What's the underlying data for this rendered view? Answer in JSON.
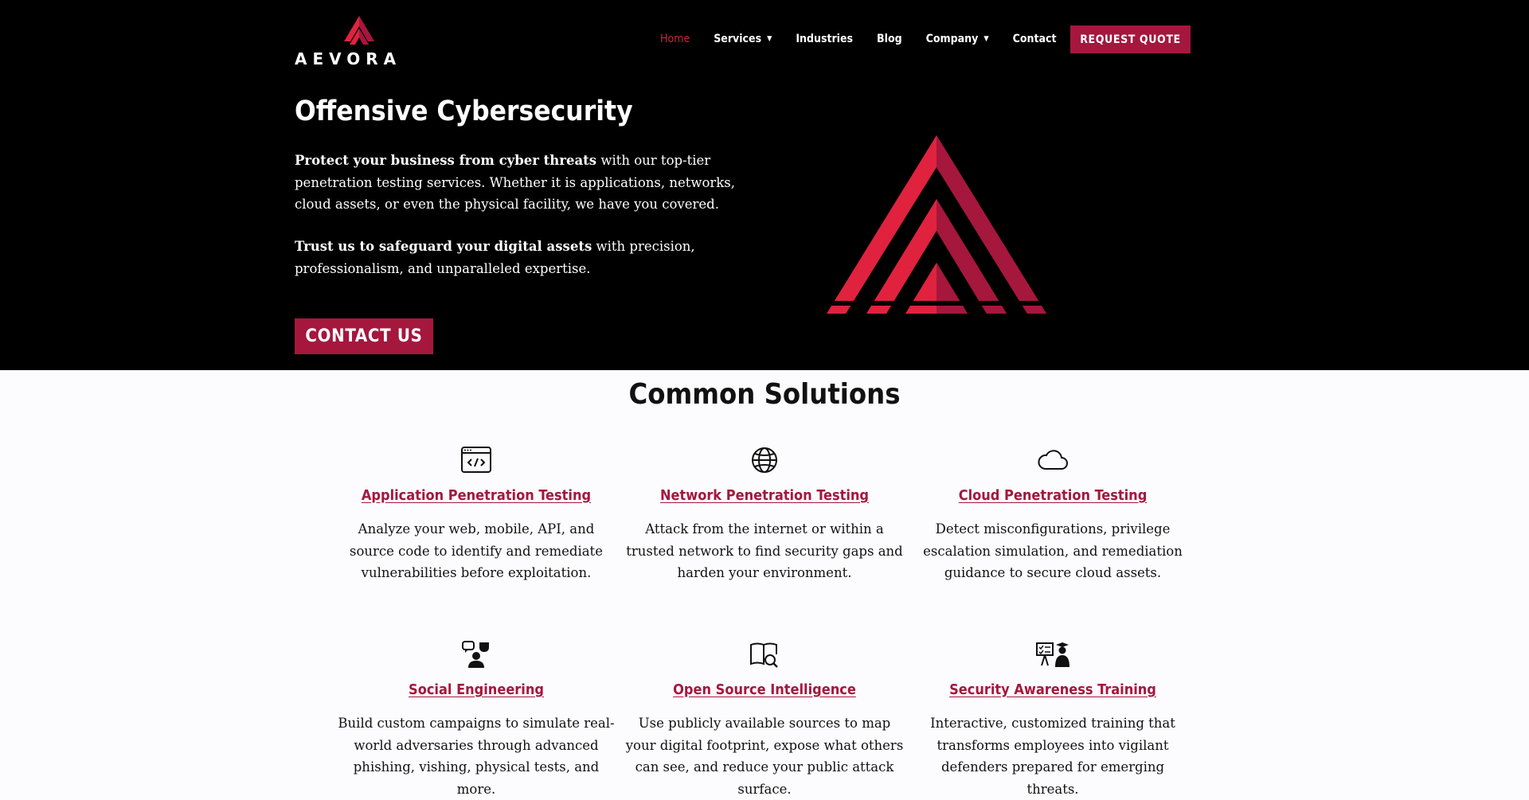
{
  "brand": {
    "name": "AEVORA",
    "accent": "#a5173d",
    "logo_red": "#e0223f"
  },
  "nav": {
    "items": [
      {
        "label": "Home",
        "active": true,
        "dropdown": false
      },
      {
        "label": "Services",
        "active": false,
        "dropdown": true
      },
      {
        "label": "Industries",
        "active": false,
        "dropdown": false
      },
      {
        "label": "Blog",
        "active": false,
        "dropdown": false
      },
      {
        "label": "Company",
        "active": false,
        "dropdown": true
      },
      {
        "label": "Contact",
        "active": false,
        "dropdown": false
      }
    ],
    "cta": "REQUEST QUOTE"
  },
  "hero": {
    "title": "Offensive Cybersecurity",
    "p1_bold": "Protect your business from cyber threats",
    "p1_rest": " with our top-tier penetration testing services. Whether it is applications, networks, cloud assets, or even the physical facility, we have you covered.",
    "p2_bold": "Trust us to safeguard your digital assets",
    "p2_rest": " with precision, professionalism, and unparalleled expertise.",
    "cta": "CONTACT US"
  },
  "solutions": {
    "title": "Common Solutions",
    "cards": [
      {
        "icon": "code-window-icon",
        "title": "Application Penetration Testing",
        "desc": "Analyze your web, mobile, API, and source code to identify and remediate vulnerabilities before exploitation."
      },
      {
        "icon": "globe-icon",
        "title": "Network Penetration Testing",
        "desc": "Attack from the internet or within a trusted network to find security gaps and harden your environment."
      },
      {
        "icon": "cloud-icon",
        "title": "Cloud Penetration Testing",
        "desc": "Detect misconfigurations, privilege escalation simulation, and remediation guidance to secure cloud assets."
      },
      {
        "icon": "social-engineering-icon",
        "title": "Social Engineering",
        "desc": "Build custom campaigns to simulate real-world adversaries through advanced phishing, vishing, physical tests, and more."
      },
      {
        "icon": "book-search-icon",
        "title": "Open Source Intelligence",
        "desc": "Use publicly available sources to map your digital footprint, expose what others can see, and reduce your public attack surface."
      },
      {
        "icon": "training-icon",
        "title": "Security Awareness Training",
        "desc": "Interactive, customized training that transforms employees into vigilant defenders prepared for emerging threats."
      }
    ]
  }
}
